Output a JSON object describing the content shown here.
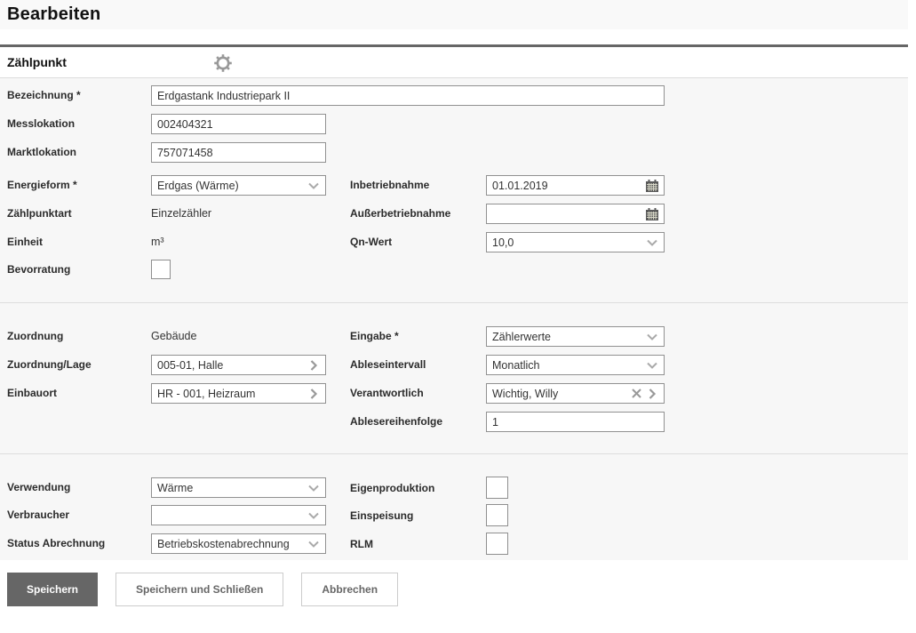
{
  "page": {
    "title": "Bearbeiten"
  },
  "panel": {
    "title": "Zählpunkt"
  },
  "colors": {
    "primary_button_bg": "#666666",
    "form_body_bg": "#f7f7f7",
    "input_border": "#919191",
    "dark_rule": "#666666",
    "light_rule": "#dddddd"
  },
  "fields": {
    "bezeichnung": {
      "label": "Bezeichnung *",
      "value": "Erdgastank Industriepark II"
    },
    "messlokation": {
      "label": "Messlokation",
      "value": "002404321"
    },
    "marktlokation": {
      "label": "Marktlokation",
      "value": "757071458"
    },
    "energieform": {
      "label": "Energieform *",
      "value": "Erdgas (Wärme)"
    },
    "zaehlpunktart": {
      "label": "Zählpunktart",
      "value": "Einzelzähler"
    },
    "einheit": {
      "label": "Einheit",
      "value": "m³"
    },
    "bevorratung": {
      "label": "Bevorratung",
      "checked": false
    },
    "inbetriebnahme": {
      "label": "Inbetriebnahme",
      "value": "01.01.2019"
    },
    "ausserbetriebnahme": {
      "label": "Außerbetriebnahme",
      "value": ""
    },
    "qn_wert": {
      "label": "Qn-Wert",
      "value": "10,0"
    },
    "zuordnung": {
      "label": "Zuordnung",
      "value": "Gebäude"
    },
    "zuordnung_lage": {
      "label": "Zuordnung/Lage",
      "value": "005-01, Halle"
    },
    "einbauort": {
      "label": "Einbauort",
      "value": "HR - 001, Heizraum"
    },
    "eingabe": {
      "label": "Eingabe *",
      "value": "Zählerwerte"
    },
    "ableseintervall": {
      "label": "Ableseintervall",
      "value": "Monatlich"
    },
    "verantwortlich": {
      "label": "Verantwortlich",
      "value": "Wichtig, Willy"
    },
    "ablesereihenfolge": {
      "label": "Ablesereihenfolge",
      "value": "1"
    },
    "verwendung": {
      "label": "Verwendung",
      "value": "Wärme"
    },
    "verbraucher": {
      "label": "Verbraucher",
      "value": ""
    },
    "status_abrechnung": {
      "label": "Status Abrechnung",
      "value": "Betriebskostenabrechnung"
    },
    "eigenproduktion": {
      "label": "Eigenproduktion",
      "checked": false
    },
    "einspeisung": {
      "label": "Einspeisung",
      "checked": false
    },
    "rlm": {
      "label": "RLM",
      "checked": false
    }
  },
  "buttons": {
    "save": "Speichern",
    "save_close": "Speichern und Schließen",
    "cancel": "Abbrechen"
  }
}
